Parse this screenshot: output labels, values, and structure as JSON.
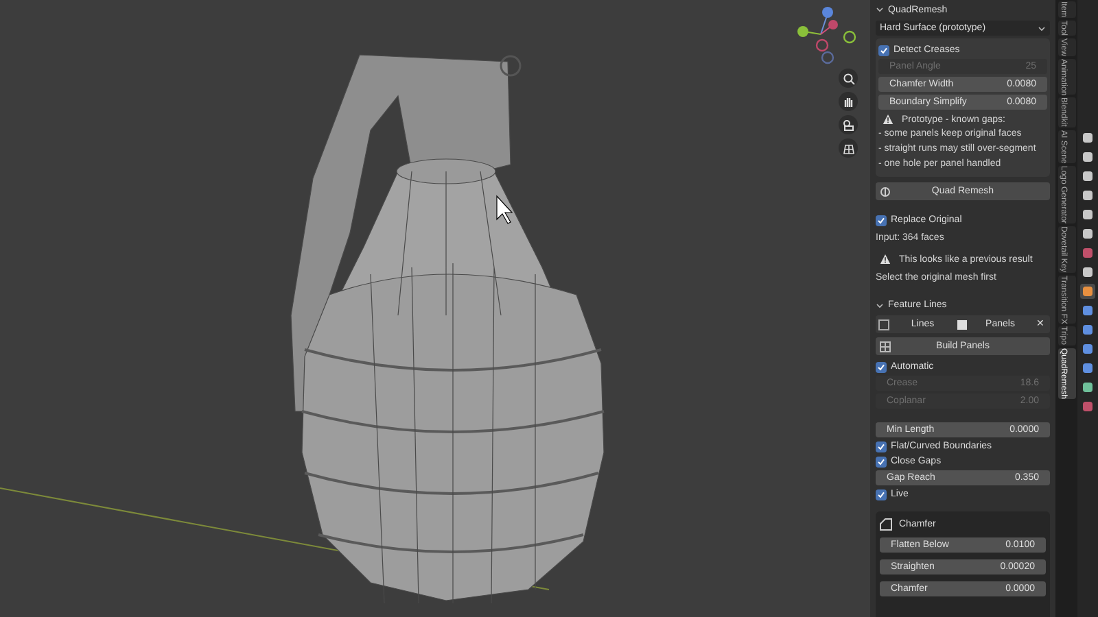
{
  "panel": {
    "title": "QuadRemesh",
    "expanded": true,
    "preset": "Hard Surface (prototype)",
    "box_items": [
      {
        "kind": "checkbox",
        "label": "Detect Creases",
        "checked": true
      },
      {
        "kind": "field",
        "label": "Panel Angle",
        "value": "25",
        "disabled": true
      },
      {
        "kind": "field",
        "label": "Chamfer Width",
        "value": "0.0080",
        "disabled": false
      },
      {
        "kind": "field",
        "label": "Boundary Simplify",
        "value": "0.0080",
        "disabled": false
      },
      {
        "kind": "warning",
        "label": "Prototype - known gaps:"
      },
      {
        "kind": "text",
        "label": "- some panels keep original faces"
      },
      {
        "kind": "text",
        "label": "- straight runs may still over-segment"
      },
      {
        "kind": "text",
        "label": "- one hole per panel handled"
      }
    ],
    "remesh_button": "Quad Remesh",
    "items": [
      {
        "kind": "checkbox",
        "label": "Replace Original",
        "checked": true
      },
      {
        "kind": "text",
        "label": "Input: 364 faces"
      },
      {
        "kind": "warning",
        "label": "This looks like a previous result"
      },
      {
        "kind": "text",
        "label": "Select the original mesh first"
      }
    ],
    "feature_lines": {
      "title": "Feature Lines",
      "expanded": true,
      "toggle_left": "Lines",
      "toggle_right": "Panels",
      "close": "✕",
      "build_button": "Build Panels",
      "items": [
        {
          "kind": "checkbox",
          "label": "Automatic",
          "checked": true
        },
        {
          "kind": "field",
          "label": "Crease",
          "value": "18.6",
          "disabled": true
        },
        {
          "kind": "field",
          "label": "Coplanar",
          "value": "2.00",
          "disabled": true
        },
        {
          "kind": "gap"
        },
        {
          "kind": "field",
          "label": "Min Length",
          "value": "0.0000",
          "disabled": false
        },
        {
          "kind": "checkbox",
          "label": "Flat/Curved Boundaries",
          "checked": true
        },
        {
          "kind": "checkbox",
          "label": "Close Gaps",
          "checked": true
        },
        {
          "kind": "field",
          "label": "Gap Reach",
          "value": "0.350",
          "disabled": false
        },
        {
          "kind": "checkbox",
          "label": "Live",
          "checked": true
        }
      ]
    },
    "chamfer": {
      "title": "Chamfer",
      "items": [
        {
          "kind": "field",
          "label": "Flatten Below",
          "value": "0.0100",
          "disabled": false
        },
        {
          "kind": "field",
          "label": "Straighten",
          "value": "0.00020",
          "disabled": false
        },
        {
          "kind": "field",
          "label": "Chamfer",
          "value": "0.0000",
          "disabled": false
        }
      ]
    }
  },
  "side_tabs": [
    {
      "label": "Item",
      "selected": false
    },
    {
      "label": "Tool",
      "selected": false
    },
    {
      "label": "View",
      "selected": false
    },
    {
      "label": "Animation",
      "selected": false
    },
    {
      "label": "Blendkit",
      "selected": false
    },
    {
      "label": "AI Scene",
      "selected": false
    },
    {
      "label": "Logo Generator",
      "selected": false
    },
    {
      "label": "Dovetail Key",
      "selected": false
    },
    {
      "label": "Transition FX",
      "selected": false
    },
    {
      "label": "Tripo",
      "selected": false
    },
    {
      "label": "QuadRemesh",
      "selected": true
    }
  ],
  "property_tabs": [
    {
      "color": "#c8c8c8",
      "selected": false
    },
    {
      "color": "#c8c8c8",
      "selected": false
    },
    {
      "color": "#c8c8c8",
      "selected": false
    },
    {
      "color": "#c8c8c8",
      "selected": false
    },
    {
      "color": "#c8c8c8",
      "selected": false
    },
    {
      "color": "#c8c8c8",
      "selected": false
    },
    {
      "color": "#c0506a",
      "selected": false
    },
    {
      "color": "#c8c8c8",
      "selected": false
    },
    {
      "color": "#e89040",
      "selected": true
    },
    {
      "color": "#5f8fe0",
      "selected": false
    },
    {
      "color": "#5f8fe0",
      "selected": false
    },
    {
      "color": "#5f8fe0",
      "selected": false
    },
    {
      "color": "#5f8fe0",
      "selected": false
    },
    {
      "color": "#6fc09a",
      "selected": false
    },
    {
      "color": "#c0506a",
      "selected": false
    }
  ]
}
